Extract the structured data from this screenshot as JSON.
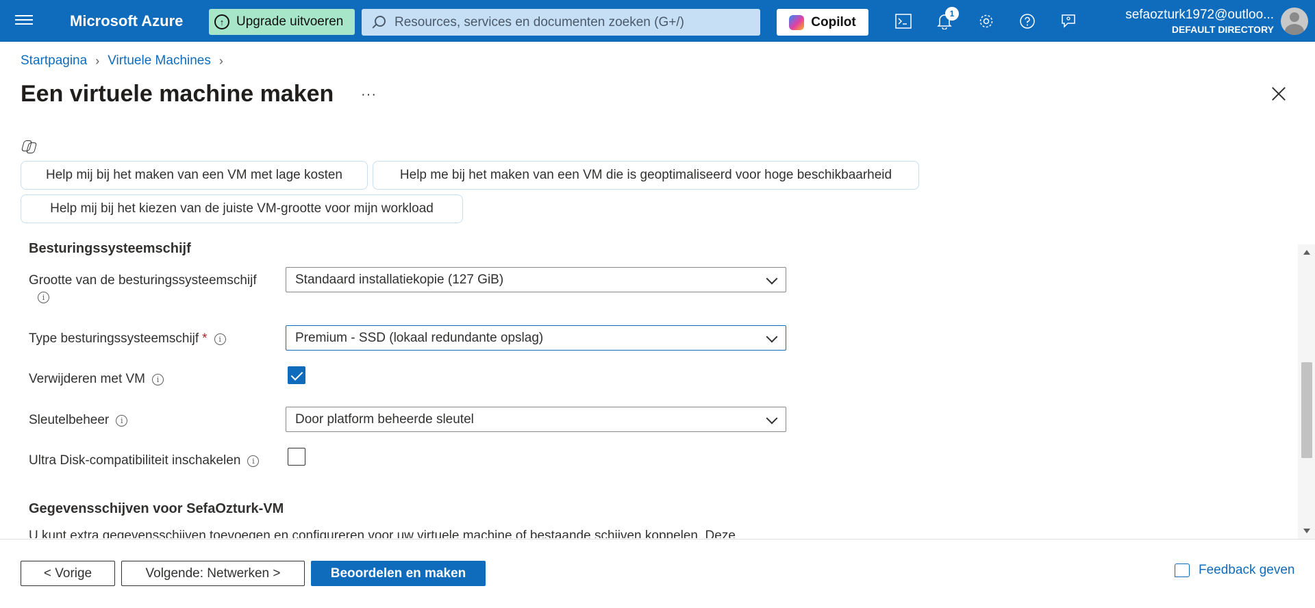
{
  "topbar": {
    "brand": "Microsoft Azure",
    "upgrade_label": "Upgrade uitvoeren",
    "search_placeholder": "Resources, services en documenten zoeken (G+/)",
    "copilot_label": "Copilot",
    "notification_count": "1",
    "account_email": "sefaozturk1972@outloo...",
    "account_directory": "DEFAULT DIRECTORY",
    "icons": [
      "cloud-shell-icon",
      "bell-icon",
      "gear-icon",
      "help-icon",
      "feedback-icon"
    ]
  },
  "breadcrumb": {
    "items": [
      "Startpagina",
      "Virtuele Machines"
    ]
  },
  "page": {
    "title": "Een virtuele machine maken",
    "more": "···"
  },
  "suggestions": [
    "Help mij bij het maken van een VM met lage kosten",
    "Help me bij het maken van een VM die is geoptimaliseerd voor hoge beschikbaarheid",
    "Help mij bij het kiezen van de juiste VM-grootte voor mijn workload"
  ],
  "form": {
    "section_os_disk": "Besturingssysteemschijf",
    "os_disk_size_label": "Grootte van de besturingssysteemschijf",
    "os_disk_size_value": "Standaard installatiekopie (127 GiB)",
    "os_disk_type_label": "Type besturingssysteemschijf",
    "os_disk_type_required": "*",
    "os_disk_type_value": "Premium - SSD (lokaal redundante opslag)",
    "delete_with_vm_label": "Verwijderen met VM",
    "delete_with_vm_checked": true,
    "key_management_label": "Sleutelbeheer",
    "key_management_value": "Door platform beheerde sleutel",
    "ultra_disk_label": "Ultra Disk-compatibiliteit inschakelen",
    "ultra_disk_checked": false,
    "section_data_disks": "Gegevensschijven voor SefaOzturk-VM",
    "data_disks_description": "U kunt extra gegevensschijven toevoegen en configureren voor uw virtuele machine of bestaande schijven koppelen. Deze"
  },
  "footer": {
    "previous_label": "< Vorige",
    "next_label": "Volgende: Netwerken >",
    "review_label": "Beoordelen en maken",
    "feedback_label": "Feedback geven"
  },
  "colors": {
    "accent": "#0f6cbd",
    "upgrade_bg": "#a7e6c9",
    "required": "#a4262c"
  }
}
